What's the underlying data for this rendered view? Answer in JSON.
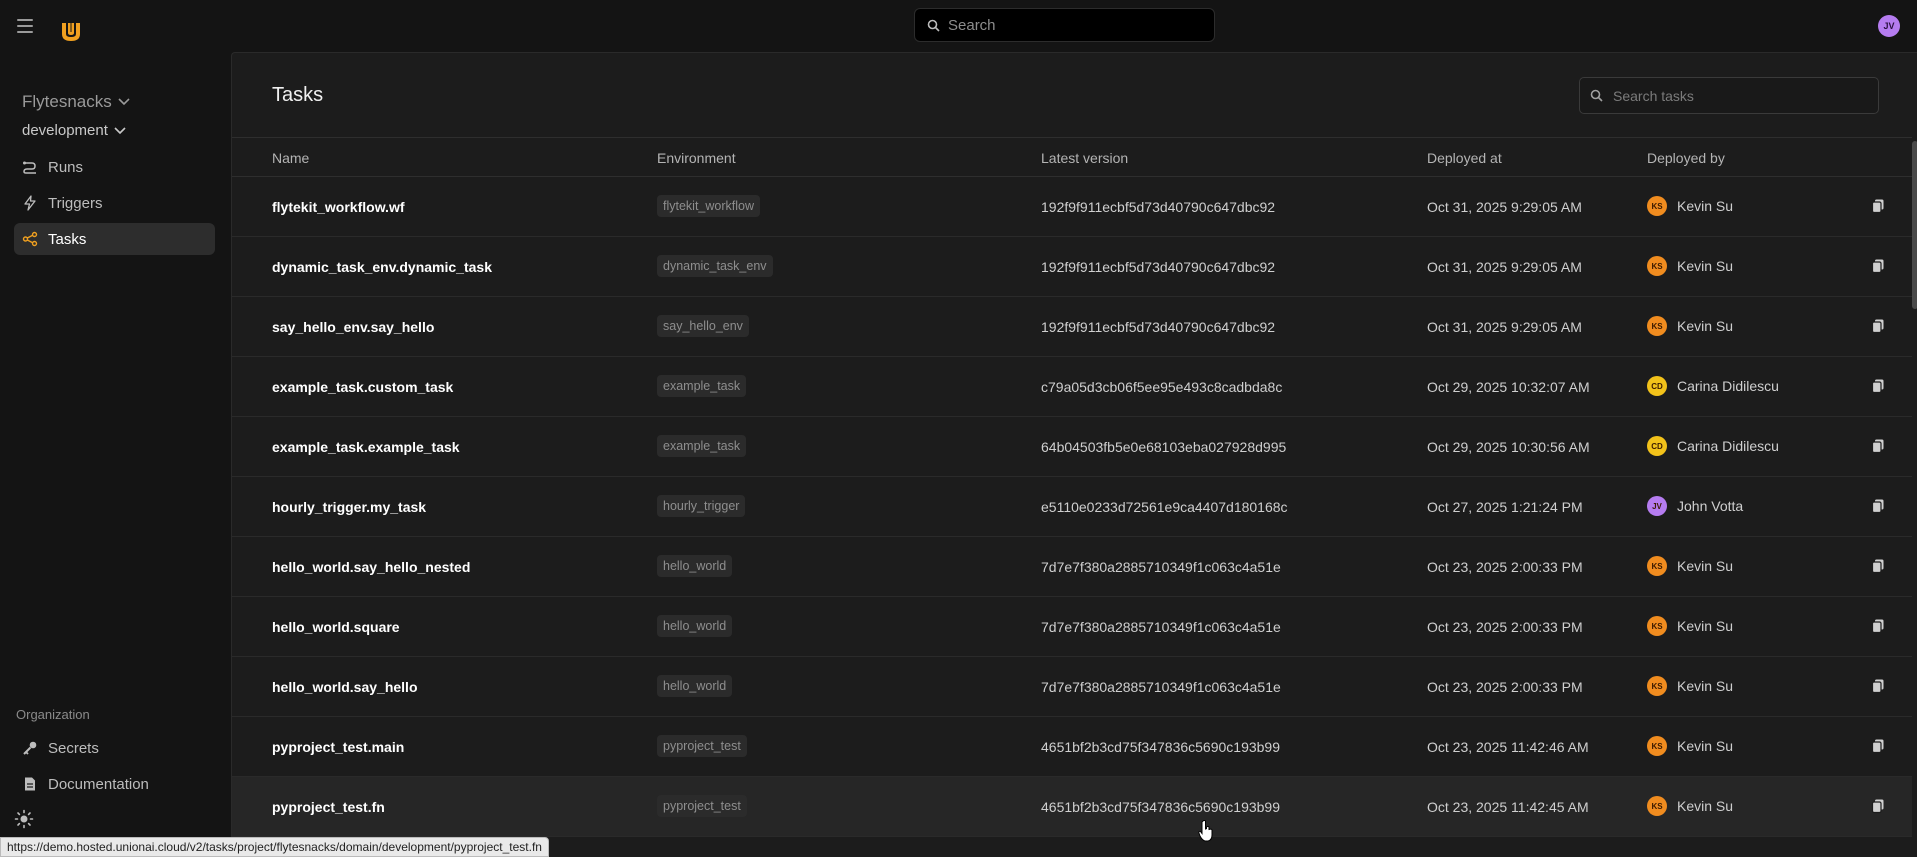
{
  "header": {
    "search_placeholder": "Search",
    "user_initials": "JV"
  },
  "sidebar": {
    "project": "Flytesnacks",
    "domain": "development",
    "nav": [
      {
        "label": "Runs",
        "icon": "runs-icon"
      },
      {
        "label": "Triggers",
        "icon": "lightning-icon"
      },
      {
        "label": "Tasks",
        "icon": "share-nodes-icon",
        "active": true
      }
    ],
    "org_label": "Organization",
    "org_nav": [
      {
        "label": "Secrets",
        "icon": "key-icon"
      },
      {
        "label": "Documentation",
        "icon": "document-icon"
      }
    ]
  },
  "main": {
    "title": "Tasks",
    "search_placeholder": "Search tasks",
    "columns": {
      "name": "Name",
      "environment": "Environment",
      "version": "Latest version",
      "deployed_at": "Deployed at",
      "deployed_by": "Deployed by"
    },
    "rows": [
      {
        "name": "flytekit_workflow.wf",
        "env": "flytekit_workflow",
        "version": "192f9f911ecbf5d73d40790c647dbc92",
        "deployed_at": "Oct 31, 2025 9:29:05 AM",
        "initials": "KS",
        "by": "Kevin Su",
        "color": "#f08c1f"
      },
      {
        "name": "dynamic_task_env.dynamic_task",
        "env": "dynamic_task_env",
        "version": "192f9f911ecbf5d73d40790c647dbc92",
        "deployed_at": "Oct 31, 2025 9:29:05 AM",
        "initials": "KS",
        "by": "Kevin Su",
        "color": "#f08c1f"
      },
      {
        "name": "say_hello_env.say_hello",
        "env": "say_hello_env",
        "version": "192f9f911ecbf5d73d40790c647dbc92",
        "deployed_at": "Oct 31, 2025 9:29:05 AM",
        "initials": "KS",
        "by": "Kevin Su",
        "color": "#f08c1f"
      },
      {
        "name": "example_task.custom_task",
        "env": "example_task",
        "version": "c79a05d3cb06f5ee95e493c8cadbda8c",
        "deployed_at": "Oct 29, 2025 10:32:07 AM",
        "initials": "CD",
        "by": "Carina Didilescu",
        "color": "#f2c21a"
      },
      {
        "name": "example_task.example_task",
        "env": "example_task",
        "version": "64b04503fb5e0e68103eba027928d995",
        "deployed_at": "Oct 29, 2025 10:30:56 AM",
        "initials": "CD",
        "by": "Carina Didilescu",
        "color": "#f2c21a"
      },
      {
        "name": "hourly_trigger.my_task",
        "env": "hourly_trigger",
        "version": "e5110e0233d72561e9ca4407d180168c",
        "deployed_at": "Oct 27, 2025 1:21:24 PM",
        "initials": "JV",
        "by": "John Votta",
        "color": "#b57cf0"
      },
      {
        "name": "hello_world.say_hello_nested",
        "env": "hello_world",
        "version": "7d7e7f380a2885710349f1c063c4a51e",
        "deployed_at": "Oct 23, 2025 2:00:33 PM",
        "initials": "KS",
        "by": "Kevin Su",
        "color": "#f08c1f"
      },
      {
        "name": "hello_world.square",
        "env": "hello_world",
        "version": "7d7e7f380a2885710349f1c063c4a51e",
        "deployed_at": "Oct 23, 2025 2:00:33 PM",
        "initials": "KS",
        "by": "Kevin Su",
        "color": "#f08c1f"
      },
      {
        "name": "hello_world.say_hello",
        "env": "hello_world",
        "version": "7d7e7f380a2885710349f1c063c4a51e",
        "deployed_at": "Oct 23, 2025 2:00:33 PM",
        "initials": "KS",
        "by": "Kevin Su",
        "color": "#f08c1f"
      },
      {
        "name": "pyproject_test.main",
        "env": "pyproject_test",
        "version": "4651bf2b3cd75f347836c5690c193b99",
        "deployed_at": "Oct 23, 2025 11:42:46 AM",
        "initials": "KS",
        "by": "Kevin Su",
        "color": "#f08c1f"
      },
      {
        "name": "pyproject_test.fn",
        "env": "pyproject_test",
        "version": "4651bf2b3cd75f347836c5690c193b99",
        "deployed_at": "Oct 23, 2025 11:42:45 AM",
        "initials": "KS",
        "by": "Kevin Su",
        "color": "#f08c1f",
        "hover": true
      }
    ]
  },
  "status_url": "https://demo.hosted.unionai.cloud/v2/tasks/project/flytesnacks/domain/development/pyproject_test.fn",
  "colors": {
    "accent": "#f0a020",
    "background": "#141414",
    "panel": "#1c1c1c"
  }
}
